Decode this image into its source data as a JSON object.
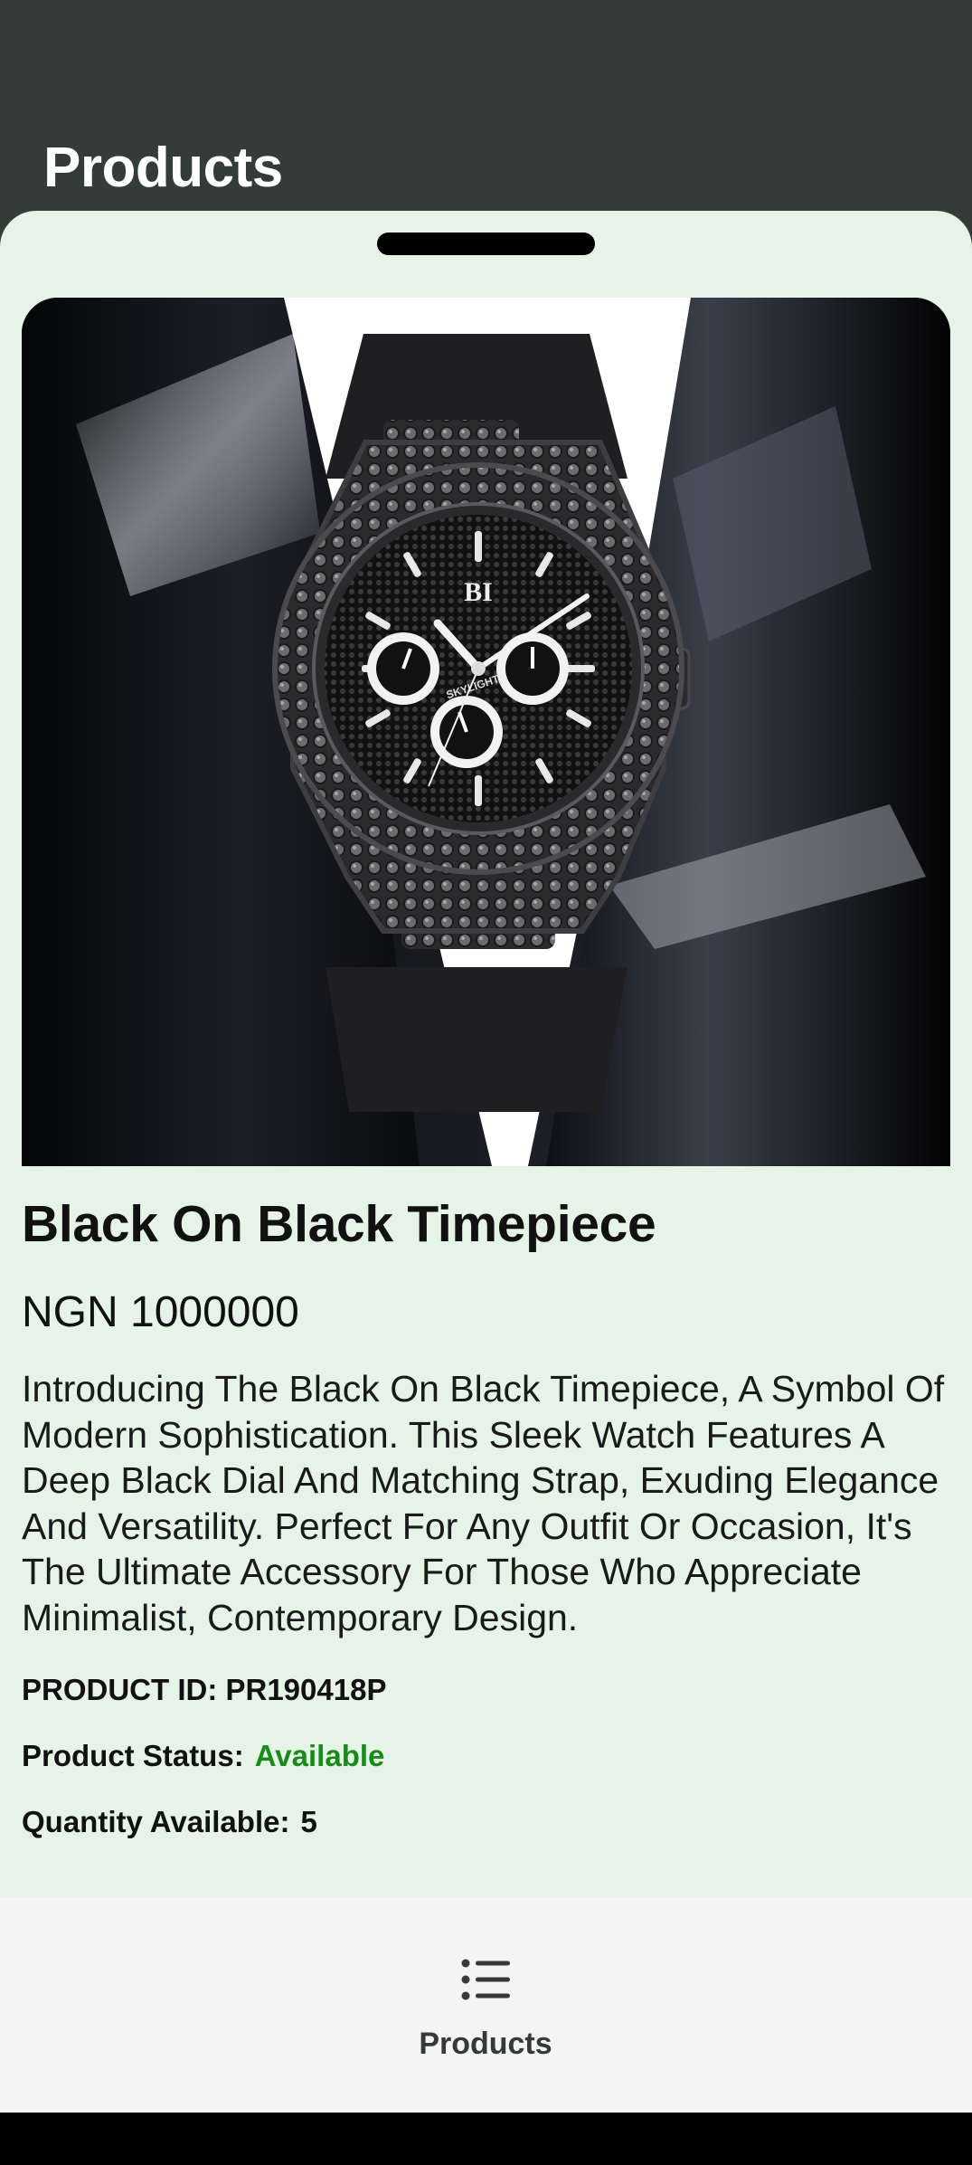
{
  "app_bar": {
    "title": "Products"
  },
  "product": {
    "image_alt": "Black On Black Timepiece watch",
    "name": "Black On Black Timepiece",
    "price": "NGN 1000000",
    "description": "Introducing The Black On Black Timepiece, A Symbol Of Modern Sophistication. This Sleek Watch Features A Deep Black Dial And Matching Strap, Exuding Elegance And Versatility. Perfect For Any Outfit Or Occasion, It's The Ultimate Accessory For Those Who Appreciate Minimalist, Contemporary Design.",
    "id_label": "PRODUCT ID: PR190418P",
    "status_label": "Product Status:",
    "status_value": "Available",
    "quantity_label": "Quantity Available:",
    "quantity_value": "5",
    "watch_brand": "BI",
    "watch_subdial_text": "SKYLIGHT"
  },
  "bottom_nav": {
    "items": [
      {
        "label": "Products",
        "icon": "list-icon",
        "active": true
      }
    ]
  },
  "colors": {
    "header_bg": "#343c39",
    "sheet_bg": "#e5f4e7",
    "available_green": "#1a8a1a",
    "nav_bg": "#f4f4f4"
  }
}
